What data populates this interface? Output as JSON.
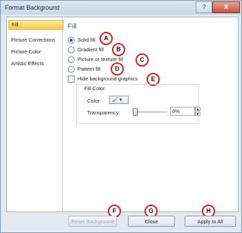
{
  "window": {
    "title": "Format Background",
    "help_label": "?",
    "close_label": "X"
  },
  "sidebar": {
    "items": [
      {
        "label": "Fill"
      },
      {
        "label": "Picture Corrections"
      },
      {
        "label": "Picture Color"
      },
      {
        "label": "Artistic Effects"
      }
    ]
  },
  "fill": {
    "heading": "Fill",
    "options": [
      {
        "label": "Solid fill",
        "selected": true
      },
      {
        "label": "Gradient fill",
        "selected": false
      },
      {
        "label": "Picture or texture fill",
        "selected": false
      },
      {
        "label": "Pattern fill",
        "selected": false
      }
    ],
    "hide_bg_label": "Hide background graphics",
    "fill_color_label": "Fill Color",
    "color_label": "Color:",
    "transparency_label": "Transparency:",
    "transparency_value": "0%",
    "transparency_level": 0
  },
  "callouts": [
    "A",
    "B",
    "C",
    "D",
    "E",
    "F",
    "G",
    "H"
  ],
  "footer": {
    "reset_label": "Reset Background",
    "close_label": "Close",
    "apply_label": "Apply to All"
  }
}
